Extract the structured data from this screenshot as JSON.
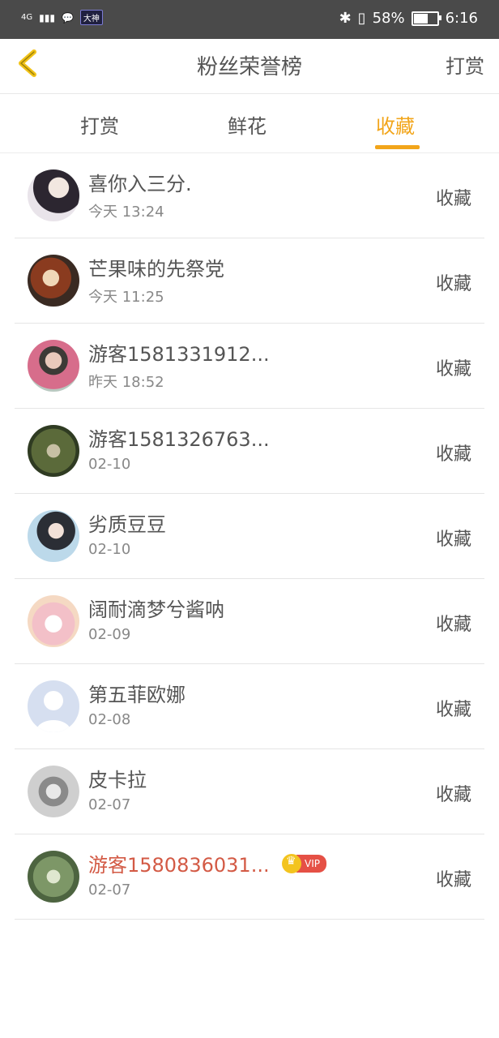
{
  "status_bar": {
    "network": "4G",
    "message_icon": "chat-bubble-icon",
    "app_badge": "大神",
    "bluetooth_icon": "bluetooth-icon",
    "vibrate_icon": "vibrate-icon",
    "battery_percent": "58%",
    "battery_level": 0.58,
    "time": "6:16"
  },
  "header": {
    "back_icon": "chevron-left-icon",
    "title": "粉丝荣誉榜",
    "action": "打赏",
    "accent_color": "#f2a51a"
  },
  "tabs": [
    {
      "label": "打赏",
      "active": false
    },
    {
      "label": "鲜花",
      "active": false
    },
    {
      "label": "收藏",
      "active": true
    }
  ],
  "list": [
    {
      "name": "喜你入三分.",
      "time": "今天 13:24",
      "action": "收藏",
      "vip": false
    },
    {
      "name": "芒果味的先祭党",
      "time": "今天 11:25",
      "action": "收藏",
      "vip": false
    },
    {
      "name": "游客1581331912...",
      "time": "昨天 18:52",
      "action": "收藏",
      "vip": false
    },
    {
      "name": "游客1581326763...",
      "time": "02-10",
      "action": "收藏",
      "vip": false
    },
    {
      "name": "劣质豆豆",
      "time": "02-10",
      "action": "收藏",
      "vip": false
    },
    {
      "name": "阔耐滴梦兮酱呐",
      "time": "02-09",
      "action": "收藏",
      "vip": false
    },
    {
      "name": "第五菲欧娜",
      "time": "02-08",
      "action": "收藏",
      "vip": false
    },
    {
      "name": "皮卡拉",
      "time": "02-07",
      "action": "收藏",
      "vip": false
    },
    {
      "name": "游客1580836031...",
      "time": "02-07",
      "action": "收藏",
      "vip": true,
      "vip_label": "VIP"
    }
  ]
}
